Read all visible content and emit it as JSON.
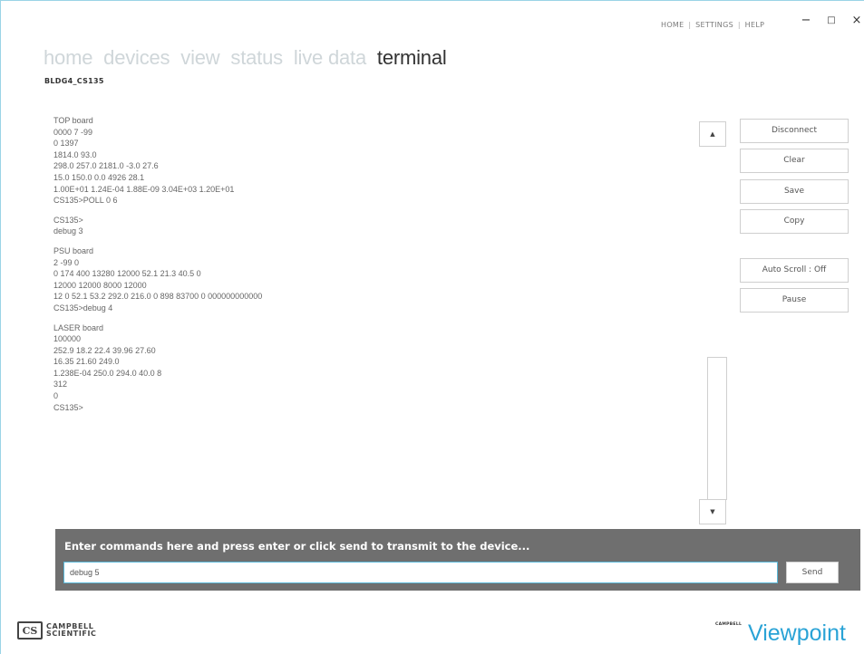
{
  "header": {
    "links": [
      "HOME",
      "SETTINGS",
      "HELP"
    ],
    "link_separator": "|",
    "window_controls": {
      "minimize": "−",
      "maximize": "□",
      "close": "×"
    }
  },
  "nav": {
    "tabs": [
      {
        "label": "home",
        "active": false
      },
      {
        "label": "devices",
        "active": false
      },
      {
        "label": "view",
        "active": false
      },
      {
        "label": "status",
        "active": false
      },
      {
        "label": "live data",
        "active": false
      },
      {
        "label": "terminal",
        "active": true
      }
    ]
  },
  "device": {
    "name": "BLDG4_CS135"
  },
  "terminal": {
    "lines": [
      "TOP board",
      "0000 7 -99",
      "0 1397",
      "1814.0 93.0",
      "298.0 257.0 2181.0 -3.0 27.6",
      "15.0 150.0 0.0 4926 28.1",
      "1.00E+01 1.24E-04 1.88E-09 3.04E+03 1.20E+01",
      "CS135>POLL 0 6",
      "",
      "CS135>",
      "debug 3",
      "",
      "PSU board",
      "2 -99 0",
      "0 174 400 13280 12000 52.1 21.3 40.5 0",
      "12000 12000 8000 12000",
      "12 0 52.1 53.2 292.0 216.0 0 898 83700 0 000000000000",
      "CS135>debug 4",
      "",
      "LASER board",
      "100000",
      "252.9 18.2 22.4 39.96 27.60",
      "16.35 21.60 249.0",
      "1.238E-04 250.0 294.0 40.0 8",
      "312",
      "0",
      "CS135>"
    ]
  },
  "scrollbar": {
    "up_icon": "▲",
    "down_icon": "▼"
  },
  "actions": {
    "disconnect": "Disconnect",
    "clear": "Clear",
    "save": "Save",
    "copy": "Copy",
    "auto_scroll": "Auto Scroll : Off",
    "pause": "Pause"
  },
  "command": {
    "label": "Enter commands here and press enter or click send to transmit to the device...",
    "value": "debug 5",
    "send": "Send"
  },
  "footer": {
    "left_logo": {
      "mark": "CS",
      "line1": "CAMPBELL",
      "line2": "SCIENTIFIC"
    },
    "right_logo": {
      "small": "CAMPBELL",
      "text": "Viewpoint"
    }
  },
  "colors": {
    "accent": "#2aa3d6",
    "nav_inactive": "#cfd6d9",
    "command_panel": "#6f6f6f",
    "window_border": "#9ad4e6"
  }
}
